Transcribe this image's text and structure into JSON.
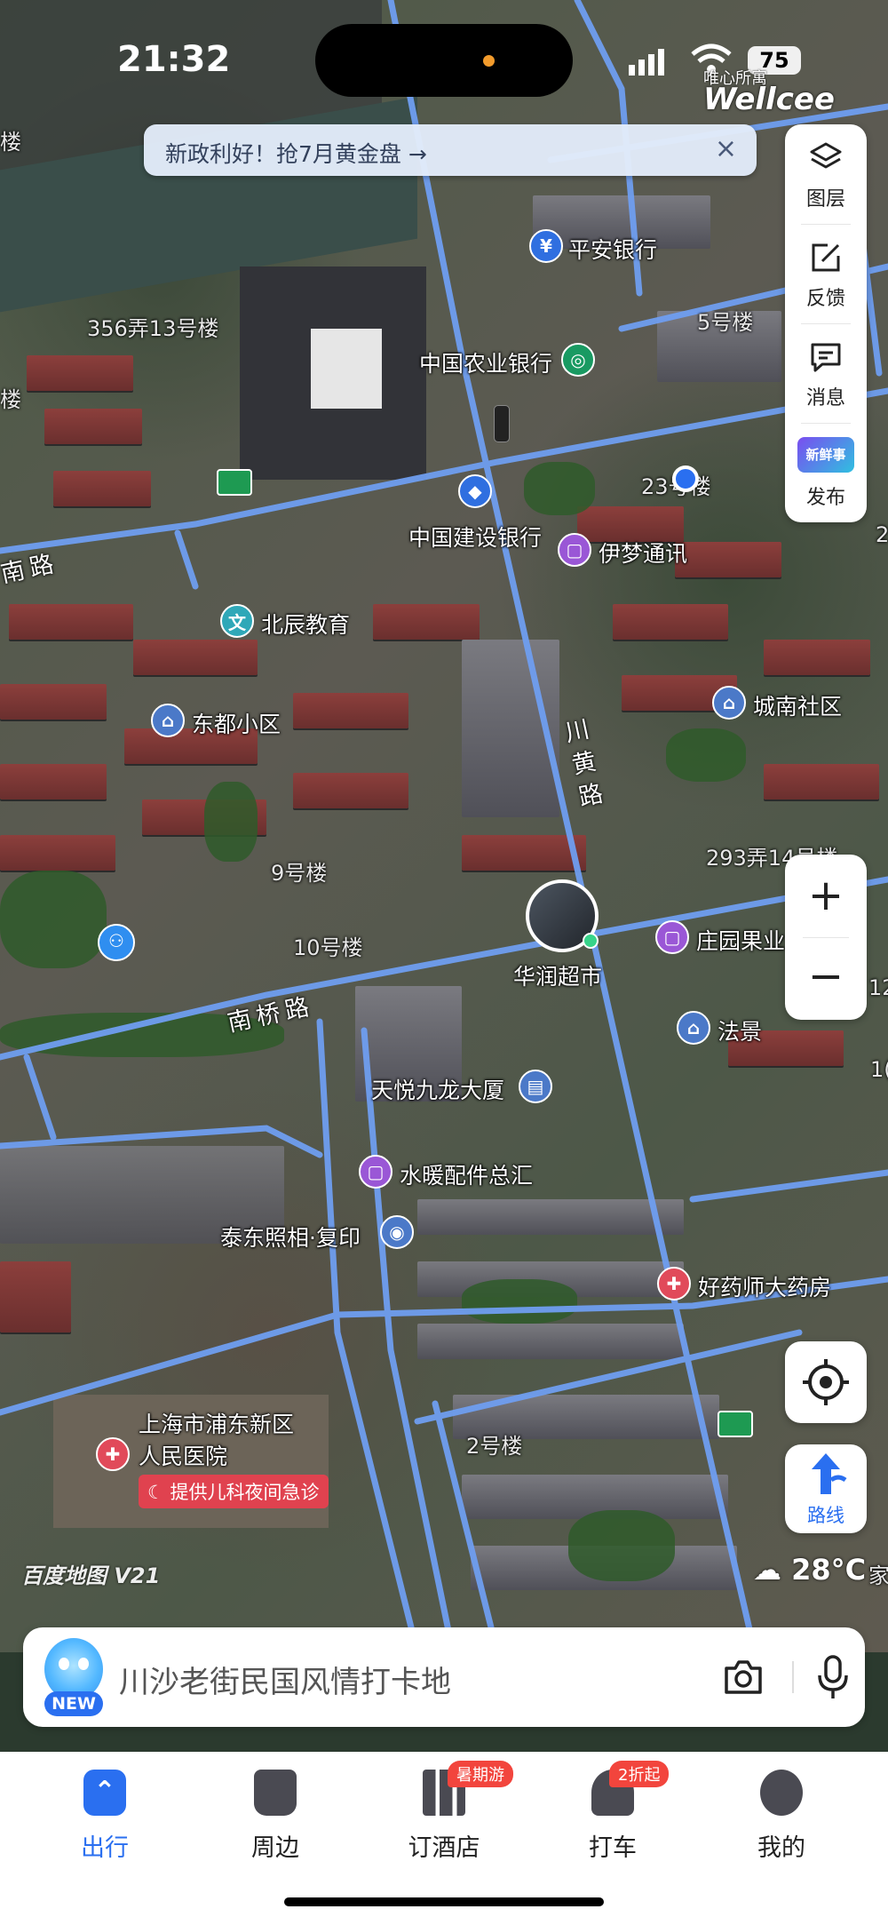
{
  "status_bar": {
    "time": "21:32",
    "battery": "75",
    "watermark_small": "唯心所寓",
    "watermark_brand": "Wellcee"
  },
  "banner": {
    "text": "新政利好！抢7月黄金盘 →",
    "close": "×"
  },
  "tools": [
    {
      "label": "图层",
      "icon": "layers-icon"
    },
    {
      "label": "反馈",
      "icon": "edit-icon"
    },
    {
      "label": "消息",
      "icon": "message-icon"
    },
    {
      "label": "发布",
      "icon": "publish-icon",
      "badge": "新鲜事"
    }
  ],
  "zoom": {
    "in": "+",
    "out": "−"
  },
  "route_label": "路线",
  "weather": "28°C",
  "map": {
    "logo": "百度地图 V21",
    "roads": [
      "南桥路",
      "川黄路"
    ],
    "buildings": [
      "356弄13号楼",
      "5号楼",
      "293弄14号楼",
      "9号楼",
      "10号楼",
      "2号楼",
      "23号楼"
    ],
    "pois": [
      {
        "name": "平安银行",
        "type": "bank"
      },
      {
        "name": "中国农业银行",
        "type": "bank"
      },
      {
        "name": "中国建设银行",
        "type": "bank"
      },
      {
        "name": "伊梦通讯",
        "type": "shop"
      },
      {
        "name": "北辰教育",
        "type": "education"
      },
      {
        "name": "东都小区",
        "type": "residence"
      },
      {
        "name": "城南社区",
        "type": "residence"
      },
      {
        "name": "华润超市",
        "type": "supermarket"
      },
      {
        "name": "庄园果业",
        "type": "shop"
      },
      {
        "name": "法景",
        "type": "residence"
      },
      {
        "name": "天悦九龙大厦",
        "type": "building"
      },
      {
        "name": "水暖配件总汇",
        "type": "shop"
      },
      {
        "name": "泰东照相·复印",
        "type": "photo"
      },
      {
        "name": "好药师大药房",
        "type": "pharmacy"
      },
      {
        "name": "上海市浦东新区",
        "type": "hospital"
      },
      {
        "name": "人民医院",
        "type": "hospital"
      }
    ],
    "hospital_tag": "提供儿科夜间急诊",
    "edge_labels": [
      "楼",
      "楼",
      "南路",
      "12",
      "1(",
      "家",
      "2"
    ]
  },
  "search": {
    "placeholder": "川沙老街民国风情打卡地",
    "new_badge": "NEW"
  },
  "nav": [
    {
      "label": "出行",
      "active": true
    },
    {
      "label": "周边",
      "active": false
    },
    {
      "label": "订酒店",
      "active": false,
      "badge": "暑期游"
    },
    {
      "label": "打车",
      "active": false,
      "badge": "2折起"
    },
    {
      "label": "我的",
      "active": false
    }
  ],
  "colors": {
    "accent": "#2a6ff0",
    "road": "#6f9ef0",
    "badge_red": "#f2453d"
  }
}
